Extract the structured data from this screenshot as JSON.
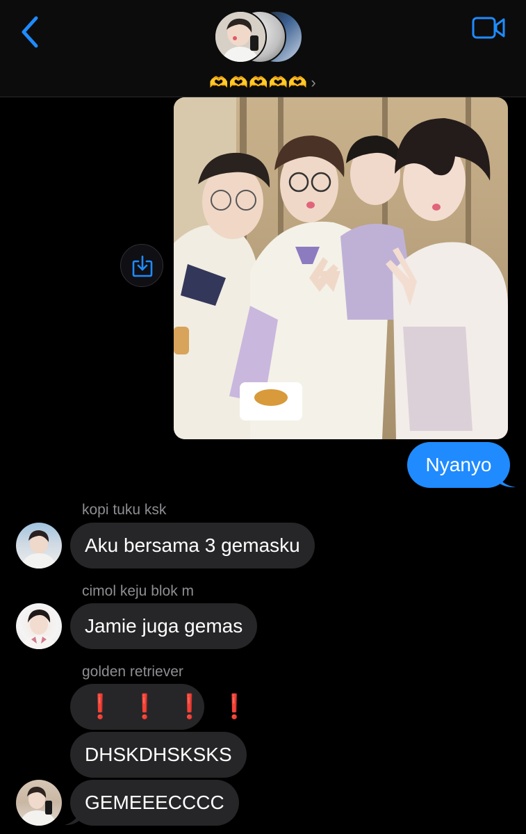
{
  "header": {
    "back_icon": "chevron-left-icon",
    "video_icon": "video-camera-icon",
    "group_name": "🫶🫶🫶🫶🫶",
    "chevron": "›",
    "accent_color": "#1f8bff"
  },
  "messages": {
    "outgoing": [
      {
        "type": "image",
        "description_icon": "photo"
      },
      {
        "type": "text",
        "text": "Nyanyo"
      }
    ],
    "incoming": [
      {
        "sender": "kopi tuku ksk",
        "bubbles": [
          "Aku bersama 3 gemasku"
        ]
      },
      {
        "sender": "cimol keju blok m",
        "bubbles": [
          "Jamie juga gemas"
        ]
      },
      {
        "sender": "golden retriever",
        "bubbles": [
          "❗❗❗❗",
          "DHSKDHSKSKS",
          "GEMEEECCCC"
        ]
      }
    ]
  },
  "save_icon": "save-download-icon",
  "colors": {
    "outgoing_bubble": "#1f8bff",
    "incoming_bubble": "#262628",
    "sender_name": "#8e8e93",
    "background": "#000000"
  }
}
